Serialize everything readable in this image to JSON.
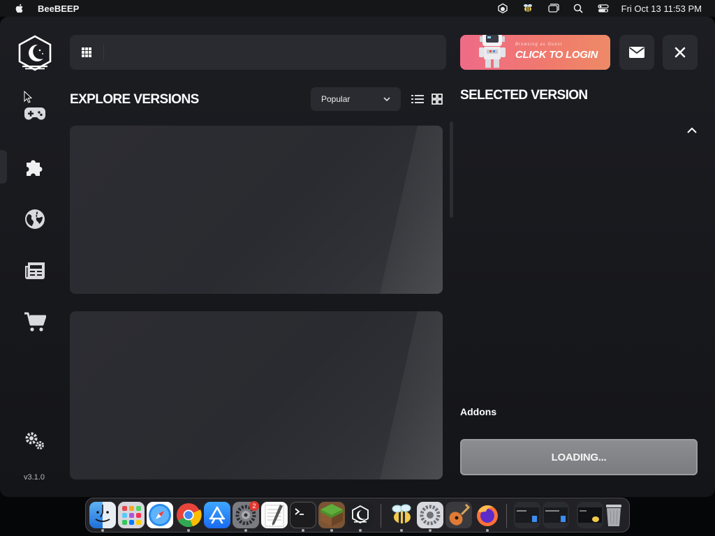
{
  "menubar": {
    "app_name": "BeeBEEP",
    "clock": "Fri Oct 13  11:53 PM",
    "status_icons": [
      "launcher-icon",
      "bee-icon",
      "window-icon",
      "search-icon",
      "control-center-icon"
    ]
  },
  "sidebar": {
    "items": [
      {
        "name": "games",
        "icon": "gamepad-icon"
      },
      {
        "name": "mods",
        "icon": "puzzle-icon",
        "active": true
      },
      {
        "name": "servers",
        "icon": "globe-icon"
      },
      {
        "name": "news",
        "icon": "newspaper-icon"
      },
      {
        "name": "store",
        "icon": "cart-icon"
      }
    ],
    "settings_icon": "gears-icon",
    "version": "v3.1.0"
  },
  "search": {
    "value": "",
    "placeholder": ""
  },
  "login": {
    "sub_label": "Browsing as Guest",
    "label": "CLICK TO LOGIN"
  },
  "explore": {
    "title": "EXPLORE VERSIONS",
    "sort": {
      "selected": "Popular"
    },
    "view_modes": [
      "list-view-icon",
      "grid-view-icon"
    ],
    "cards": [
      {
        "id": 1
      },
      {
        "id": 2
      }
    ]
  },
  "selected": {
    "title": "SELECTED VERSION",
    "addons_label": "Addons",
    "loading_label": "LOADING..."
  },
  "dock": {
    "apps": [
      "Finder",
      "Launchpad",
      "Safari",
      "Chrome",
      "App Store",
      "System Settings",
      "TextEdit",
      "Terminal",
      "Minecraft",
      "Lunar Client",
      "BeeBEEP",
      "Preferences",
      "GarageBand",
      "Firefox",
      "Window 1",
      "Window 2",
      "Window 3",
      "Trash"
    ],
    "settings_badge": "2"
  },
  "colors": {
    "background": "#17181c",
    "panel": "#2a2b30",
    "login_gradient_start": "#ef6b87",
    "login_gradient_end": "#ee8a67",
    "loading_button": "#8c8d91"
  }
}
